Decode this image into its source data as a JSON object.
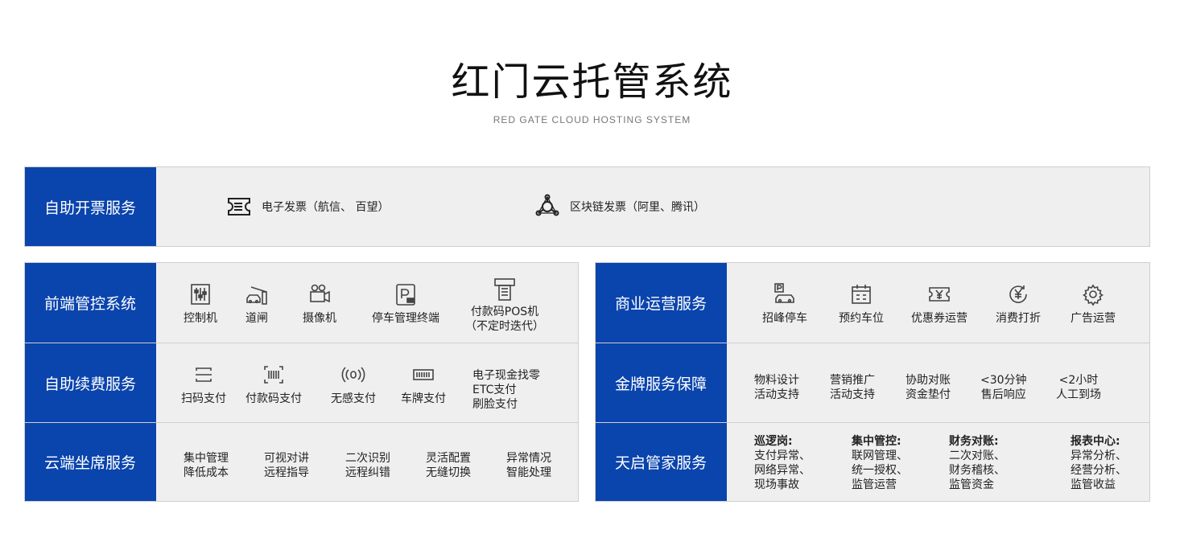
{
  "header": {
    "title": "红门云托管系统",
    "subtitle": "RED GATE CLOUD HOSTING SYSTEM"
  },
  "invoice": {
    "label": "自助开票服务",
    "items": [
      {
        "icon": "receipt-icon",
        "text": "电子发票（航信、 百望）"
      },
      {
        "icon": "blockchain-icon",
        "text": "区块链发票（阿里、腾讯）"
      }
    ]
  },
  "left_panel": {
    "front_end": {
      "label": "前端管控系统",
      "items": [
        {
          "icon": "controller-icon",
          "lines": [
            "控制机"
          ]
        },
        {
          "icon": "barrier-gate-icon",
          "lines": [
            "道闸"
          ]
        },
        {
          "icon": "camera-icon",
          "lines": [
            "摄像机"
          ]
        },
        {
          "icon": "parking-terminal-icon",
          "lines": [
            "停车管理终端"
          ]
        },
        {
          "icon": "pos-machine-icon",
          "lines": [
            "付款码POS机",
            "（不定时迭代）"
          ]
        }
      ]
    },
    "renewal": {
      "label": "自助续费服务",
      "items": [
        {
          "icon": "scan-icon",
          "lines": [
            "扫码支付"
          ]
        },
        {
          "icon": "barcode-icon",
          "lines": [
            "付款码支付"
          ]
        },
        {
          "icon": "contactless-icon",
          "lines": [
            "无感支付"
          ]
        },
        {
          "icon": "license-plate-icon",
          "lines": [
            "车牌支付"
          ]
        }
      ],
      "text_item": [
        "电子现金找零",
        "ETC支付",
        "刷脸支付"
      ]
    },
    "cloud_seat": {
      "label": "云端坐席服务",
      "items": [
        [
          "集中管理",
          "降低成本"
        ],
        [
          "可视对讲",
          "远程指导"
        ],
        [
          "二次识别",
          "远程纠错"
        ],
        [
          "灵活配置",
          "无缝切换"
        ],
        [
          "异常情况",
          "智能处理"
        ]
      ]
    }
  },
  "right_panel": {
    "business": {
      "label": "商业运营服务",
      "items": [
        {
          "icon": "parking-car-icon",
          "lines": [
            "招峰停车"
          ]
        },
        {
          "icon": "calendar-icon",
          "lines": [
            "预约车位"
          ]
        },
        {
          "icon": "coupon-icon",
          "lines": [
            "优惠券运营"
          ]
        },
        {
          "icon": "yen-circle-icon",
          "lines": [
            "消费打折"
          ]
        },
        {
          "icon": "gear-icon",
          "lines": [
            "广告运营"
          ]
        }
      ]
    },
    "gold": {
      "label": "金牌服务保障",
      "items": [
        [
          "物料设计",
          "活动支持"
        ],
        [
          "营销推广",
          "活动支持"
        ],
        [
          "协助对账",
          "资金垫付"
        ],
        [
          "<30分钟",
          "售后响应"
        ],
        [
          "<2小时",
          "人工到场"
        ]
      ]
    },
    "tianqi": {
      "label": "天启管家服务",
      "items": [
        {
          "head": "巡逻岗:",
          "lines": [
            "支付异常、",
            "网络异常、",
            "现场事故"
          ]
        },
        {
          "head": "集中管控:",
          "lines": [
            "联网管理、",
            "统一授权、",
            "监管运营"
          ]
        },
        {
          "head": "财务对账:",
          "lines": [
            "二次对账、",
            "财务稽核、",
            "监管资金"
          ]
        },
        {
          "head": "报表中心:",
          "lines": [
            "异常分析、",
            "经营分析、",
            "监管收益"
          ]
        }
      ]
    }
  }
}
